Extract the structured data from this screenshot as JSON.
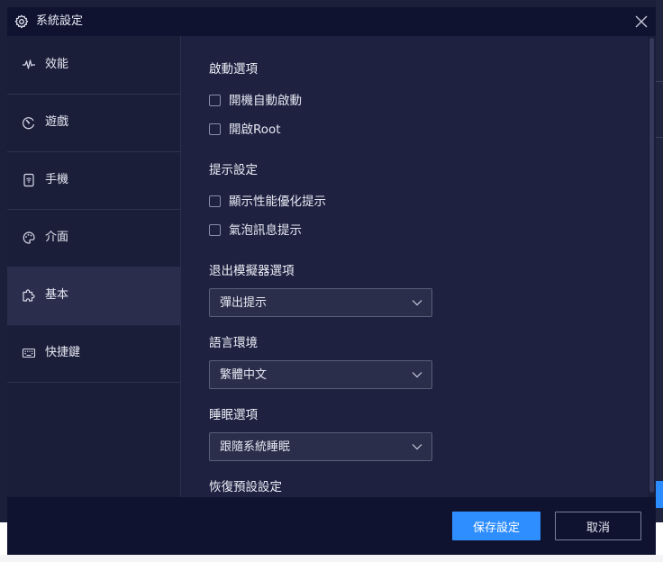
{
  "window": {
    "title": "系統設定",
    "icon": "gear-icon",
    "close_icon": "close-icon"
  },
  "sidebar": {
    "items": [
      {
        "label": "效能",
        "icon": "waveform-icon",
        "active": false
      },
      {
        "label": "遊戲",
        "icon": "gauge-icon",
        "active": false
      },
      {
        "label": "手機",
        "icon": "phone-wifi-icon",
        "active": false
      },
      {
        "label": "介面",
        "icon": "palette-icon",
        "active": false
      },
      {
        "label": "基本",
        "icon": "puzzle-icon",
        "active": true
      },
      {
        "label": "快捷鍵",
        "icon": "keyboard-icon",
        "active": false
      }
    ]
  },
  "content": {
    "startup": {
      "title": "啟動選項",
      "options": [
        {
          "label": "開機自動啟動",
          "checked": false
        },
        {
          "label": "開啟Root",
          "checked": false
        }
      ]
    },
    "notifications": {
      "title": "提示設定",
      "options": [
        {
          "label": "顯示性能優化提示",
          "checked": false
        },
        {
          "label": "氣泡訊息提示",
          "checked": false
        }
      ]
    },
    "exit": {
      "title": "退出模擬器選項",
      "selected": "彈出提示"
    },
    "language": {
      "title": "語言環境",
      "selected": "繁體中文"
    },
    "sleep": {
      "title": "睡眠選項",
      "selected": "跟隨系統睡眠"
    },
    "restore": {
      "title": "恢復預設設定"
    }
  },
  "footer": {
    "save_label": "保存設定",
    "cancel_label": "取消"
  },
  "colors": {
    "accent": "#2f8eff",
    "dialog_bg": "#1b1e39",
    "titlebar_bg": "#0f1330",
    "active_nav_bg": "#2a2e4c"
  }
}
